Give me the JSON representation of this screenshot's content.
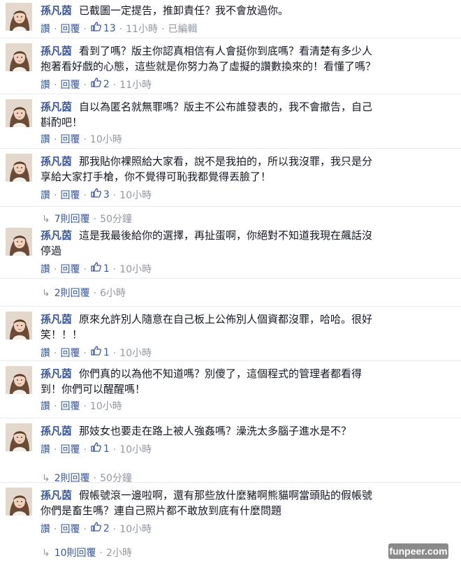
{
  "comments": [
    {
      "name": "孫凡茵",
      "lines": [
        "已截圖一定提告，推卸責任？我不會放過你。"
      ],
      "like": "讚",
      "reply": "回覆",
      "likes": "13",
      "time": "11小時",
      "edited": "已編輯"
    },
    {
      "name": "孫凡茵",
      "lines": [
        "看到了嗎？版主你認真相信有人會挺你到底嗎？看清楚有多少人",
        "抱著看好戲的心態，這些就是你努力為了虛擬的讚數換來的！看懂了嗎？"
      ],
      "like": "讚",
      "reply": "回覆",
      "likes": "2",
      "time": "11小時"
    },
    {
      "name": "孫凡茵",
      "lines": [
        "自以為匿名就無罪嗎？版主不公布誰發表的，我不會撤告，自己",
        "斟酌吧！"
      ],
      "like": "讚",
      "reply": "回覆",
      "time": "10小時"
    },
    {
      "name": "孫凡茵",
      "lines": [
        "那我貼你裸照給大家看，說不是我拍的，所以我沒罪，我只是分",
        "享給大家打手槍，你不覺得可恥我都覺得丟臉了！"
      ],
      "like": "讚",
      "reply": "回覆",
      "likes": "3",
      "time": "10小時",
      "replies": "7則回覆",
      "replies_time": "50分鐘"
    },
    {
      "name": "孫凡茵",
      "lines": [
        "這是我最後給你的選擇，再扯蛋啊，你絕對不知道我現在飆話沒",
        "停過"
      ],
      "like": "讚",
      "reply": "回覆",
      "likes": "1",
      "time": "10小時",
      "replies": "2則回覆",
      "replies_time": "6小時"
    },
    {
      "name": "孫凡茵",
      "lines": [
        "原來允許別人隨意在自己板上公佈別人個資都沒罪，哈哈。很好",
        "笑！！！"
      ],
      "like": "讚",
      "reply": "回覆",
      "likes": "1",
      "time": "10小時"
    },
    {
      "name": "孫凡茵",
      "lines": [
        "你們真的以為他不知道嗎？別傻了，這個程式的管理者都看得",
        "到！你們可以醒醒嗎！"
      ],
      "like": "讚",
      "reply": "回覆",
      "time": "10小時"
    },
    {
      "name": "孫凡茵",
      "lines": [
        "那妓女也要走在路上被人強姦嗎？澡洗太多腦子進水是不？"
      ],
      "like": "讚",
      "reply": "回覆",
      "likes": "1",
      "time": "10小時",
      "replies": "2則回覆",
      "replies_time": "50分鐘"
    },
    {
      "name": "孫凡茵",
      "lines": [
        "假帳號滾一邊啦啊，還有那些放什麼豬啊熊貓啊當頭貼的假帳號",
        "你們是畜生嗎？連自己照片都不敢放到底有什麼問題"
      ],
      "like": "讚",
      "reply": "回覆",
      "likes": "2",
      "time": "10小時",
      "replies": "10則回覆",
      "replies_time": "2小時"
    }
  ],
  "watermark": "funpeer.com",
  "colors": {
    "link": "#3b5998",
    "meta": "#9197a3",
    "text": "#141823"
  }
}
